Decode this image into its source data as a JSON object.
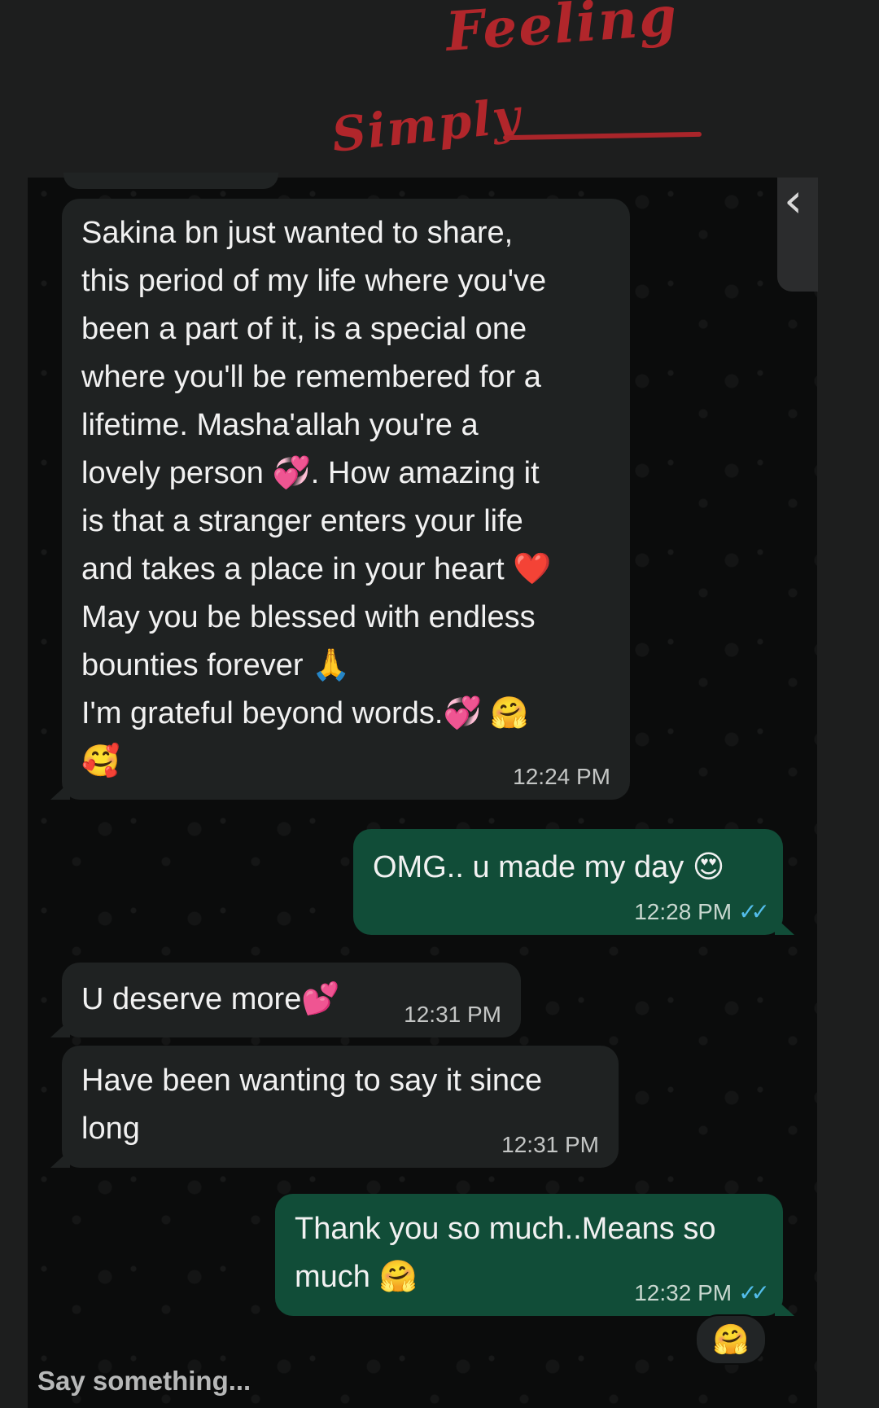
{
  "header": {
    "line1": "Feeling",
    "line2": "Simply"
  },
  "messages": [
    {
      "direction": "incoming",
      "lines": [
        "Sakina bn just wanted to share,",
        "this period of my life where you've",
        "been a part of it, is a special one",
        "where you'll be remembered for a",
        "lifetime.  Masha'allah you're a",
        "lovely person 💞.  How amazing it",
        "is that a stranger enters your life",
        "and takes a place in your heart ❤️",
        "May you be blessed with endless",
        "bounties forever 🙏",
        "I'm grateful beyond words.💞 🤗",
        "🥰"
      ],
      "time": "12:24 PM"
    },
    {
      "direction": "outgoing",
      "lines": [
        "OMG.. u made my day 😍"
      ],
      "time": "12:28 PM",
      "status": "read"
    },
    {
      "direction": "incoming",
      "lines": [
        "U deserve more💕"
      ],
      "time": "12:31 PM"
    },
    {
      "direction": "incoming",
      "lines": [
        "Have been wanting to say it since",
        "long"
      ],
      "time": "12:31 PM"
    },
    {
      "direction": "outgoing",
      "lines": [
        "Thank you so much..Means so",
        "much 🤗"
      ],
      "time": "12:32 PM",
      "status": "read"
    }
  ],
  "reaction": "🤗",
  "composer": {
    "placeholder": "Say something..."
  },
  "colors": {
    "incoming_bubble": "#1f2222",
    "outgoing_bubble": "#114d38",
    "read_ticks": "#53bdeb",
    "handwriting": "#b1262b"
  },
  "icons": {
    "back": "chevron-left-icon",
    "read_receipt": "double-check-icon"
  }
}
